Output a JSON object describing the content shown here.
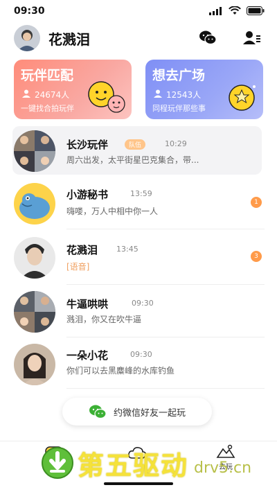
{
  "status": {
    "time": "09:30"
  },
  "header": {
    "username": "花溅泪"
  },
  "cards": [
    {
      "title": "玩伴匹配",
      "count": "24674人",
      "subtitle": "一键找合拍玩伴"
    },
    {
      "title": "想去广场",
      "count": "12543人",
      "subtitle": "同程玩伴那些事"
    }
  ],
  "chats": [
    {
      "name": "长沙玩伴",
      "tag": "队伍",
      "time": "10:29",
      "message": "周六出发，太平街星巴克集合，带..."
    },
    {
      "name": "小游秘书",
      "time": "13:59",
      "message": "嗨喽，万人中相中你一人",
      "badge": "1"
    },
    {
      "name": "花溅泪",
      "time": "13:45",
      "message": "[语音]",
      "badge": "3"
    },
    {
      "name": "牛逼哄哄",
      "time": "09:30",
      "message": "溅泪，你又在吹牛逼"
    },
    {
      "name": "一朵小花",
      "time": "09:30",
      "message": "你们可以去黑麋峰的水库钓鱼"
    }
  ],
  "invite": {
    "label": "约微信好友一起玩"
  },
  "tabs": {
    "go_play": "去玩"
  },
  "watermark": {
    "text": "第五驱动",
    "url": "drv5.cn"
  },
  "colors": {
    "accent_orange": "#ff9b4a",
    "card_pink": "#ff8c7a",
    "card_blue": "#7f8ff5",
    "wechat_green": "#3cb035"
  }
}
